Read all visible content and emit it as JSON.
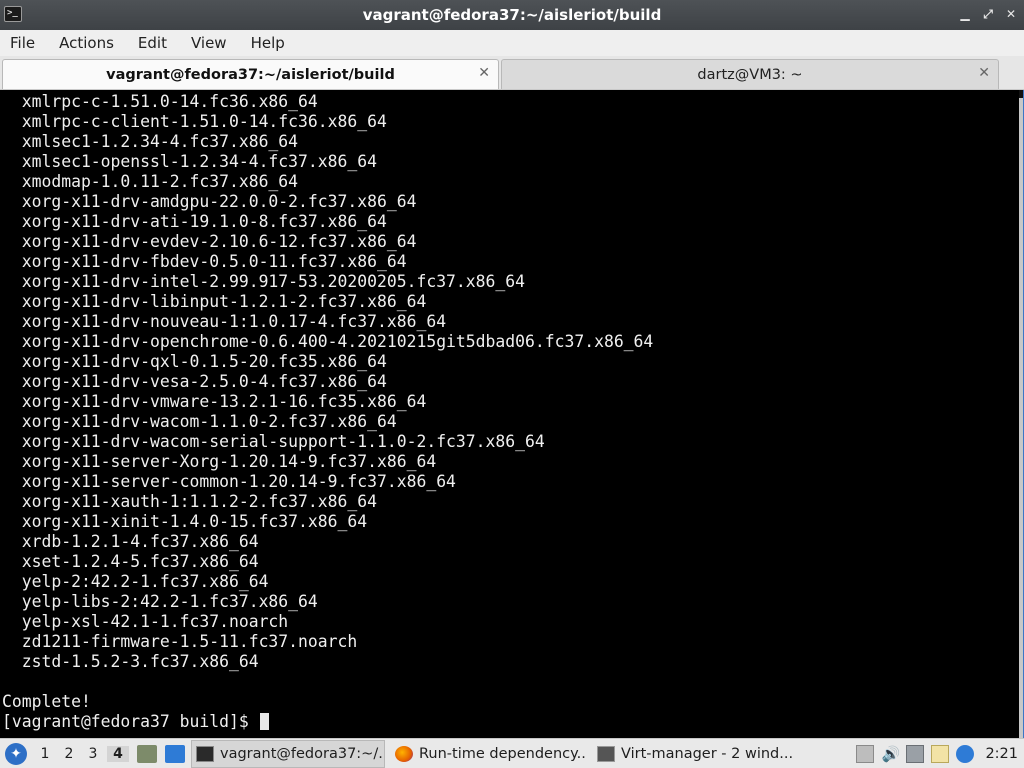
{
  "window": {
    "title": "vagrant@fedora37:~/aisleriot/build",
    "buttons": [
      "▁",
      "⤢",
      "✕"
    ]
  },
  "menu": [
    "File",
    "Actions",
    "Edit",
    "View",
    "Help"
  ],
  "tabs": [
    {
      "label": "vagrant@fedora37:~/aisleriot/build",
      "close": "✕"
    },
    {
      "label": "dartz@VM3: ~",
      "close": "✕"
    }
  ],
  "terminal": {
    "lines": [
      "  xmlrpc-c-1.51.0-14.fc36.x86_64",
      "  xmlrpc-c-client-1.51.0-14.fc36.x86_64",
      "  xmlsec1-1.2.34-4.fc37.x86_64",
      "  xmlsec1-openssl-1.2.34-4.fc37.x86_64",
      "  xmodmap-1.0.11-2.fc37.x86_64",
      "  xorg-x11-drv-amdgpu-22.0.0-2.fc37.x86_64",
      "  xorg-x11-drv-ati-19.1.0-8.fc37.x86_64",
      "  xorg-x11-drv-evdev-2.10.6-12.fc37.x86_64",
      "  xorg-x11-drv-fbdev-0.5.0-11.fc37.x86_64",
      "  xorg-x11-drv-intel-2.99.917-53.20200205.fc37.x86_64",
      "  xorg-x11-drv-libinput-1.2.1-2.fc37.x86_64",
      "  xorg-x11-drv-nouveau-1:1.0.17-4.fc37.x86_64",
      "  xorg-x11-drv-openchrome-0.6.400-4.20210215git5dbad06.fc37.x86_64",
      "  xorg-x11-drv-qxl-0.1.5-20.fc35.x86_64",
      "  xorg-x11-drv-vesa-2.5.0-4.fc37.x86_64",
      "  xorg-x11-drv-vmware-13.2.1-16.fc35.x86_64",
      "  xorg-x11-drv-wacom-1.1.0-2.fc37.x86_64",
      "  xorg-x11-drv-wacom-serial-support-1.1.0-2.fc37.x86_64",
      "  xorg-x11-server-Xorg-1.20.14-9.fc37.x86_64",
      "  xorg-x11-server-common-1.20.14-9.fc37.x86_64",
      "  xorg-x11-xauth-1:1.1.2-2.fc37.x86_64",
      "  xorg-x11-xinit-1.4.0-15.fc37.x86_64",
      "  xrdb-1.2.1-4.fc37.x86_64",
      "  xset-1.2.4-5.fc37.x86_64",
      "  yelp-2:42.2-1.fc37.x86_64",
      "  yelp-libs-2:42.2-1.fc37.x86_64",
      "  yelp-xsl-42.1-1.fc37.noarch",
      "  zd1211-firmware-1.5-11.fc37.noarch",
      "  zstd-1.5.2-3.fc37.x86_64",
      "",
      "Complete!"
    ],
    "prompt": "[vagrant@fedora37 build]$ "
  },
  "taskbar": {
    "workspaces": [
      "1",
      "2",
      "3",
      "4"
    ],
    "active_workspace": "4",
    "tasks": [
      {
        "label": "vagrant@fedora37:~/...",
        "icon": "terminal-icon"
      },
      {
        "label": "Run-time dependency...",
        "icon": "firefox-icon"
      },
      {
        "label": "Virt-manager - 2 wind...",
        "icon": "virt-manager-icon"
      }
    ],
    "clock": "2:21",
    "colors": {
      "accent": "#2d6fc6",
      "firefox": "#e66000"
    }
  }
}
